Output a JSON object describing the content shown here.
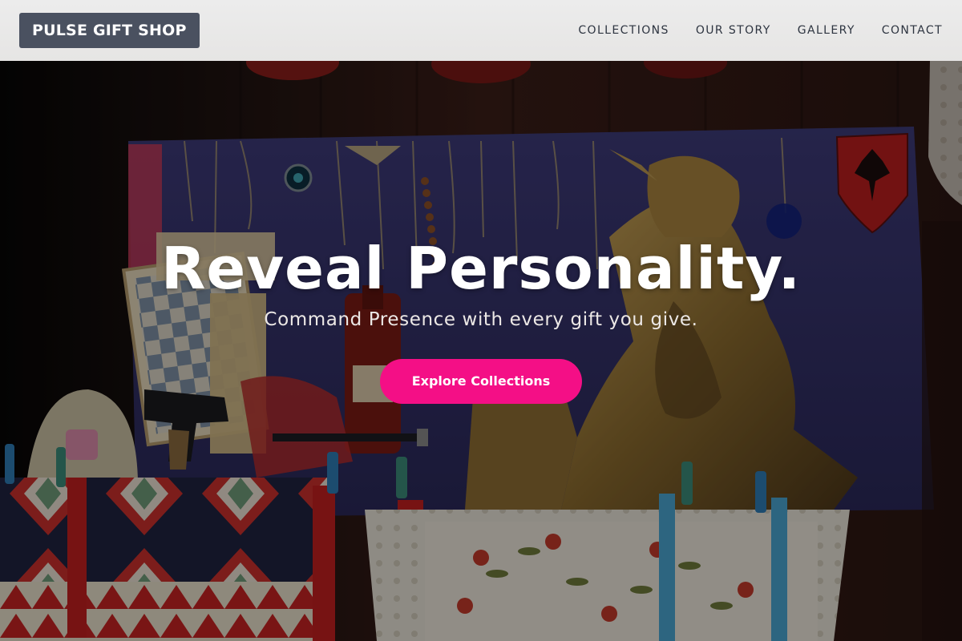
{
  "brand": {
    "logo_text": "PULSE GIFT SHOP"
  },
  "nav": {
    "items": [
      {
        "label": "COLLECTIONS"
      },
      {
        "label": "OUR STORY"
      },
      {
        "label": "GALLERY"
      },
      {
        "label": "CONTACT"
      }
    ]
  },
  "hero": {
    "title": "Reveal Personality.",
    "subtitle": "Command Presence with every gift you give.",
    "cta_label": "Explore Collections"
  },
  "colors": {
    "header_bg": "#ececec",
    "logo_bg": "#4a5160",
    "nav_text": "#2d3440",
    "cta_bg": "#f40f86",
    "hero_text": "#ffffff"
  }
}
